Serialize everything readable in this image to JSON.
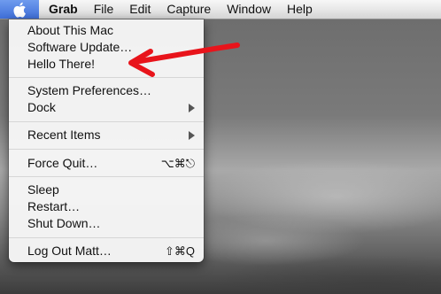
{
  "menubar": {
    "apple_icon": "apple-logo-icon",
    "items": [
      "Grab",
      "File",
      "Edit",
      "Capture",
      "Window",
      "Help"
    ]
  },
  "apple_menu": {
    "groups": [
      [
        {
          "label": "About This Mac"
        },
        {
          "label": "Software Update…"
        },
        {
          "label": "Hello There!"
        }
      ],
      [
        {
          "label": "System Preferences…"
        },
        {
          "label": "Dock",
          "submenu": true
        }
      ],
      [
        {
          "label": "Recent Items",
          "submenu": true
        }
      ],
      [
        {
          "label": "Force Quit…",
          "shortcut": "⌥⌘⎋"
        }
      ],
      [
        {
          "label": "Sleep"
        },
        {
          "label": "Restart…"
        },
        {
          "label": "Shut Down…"
        }
      ],
      [
        {
          "label": "Log Out Matt…",
          "shortcut": "⇧⌘Q"
        }
      ]
    ]
  },
  "annotation": {
    "color": "#e8141b",
    "points_to": "Hello There!"
  }
}
